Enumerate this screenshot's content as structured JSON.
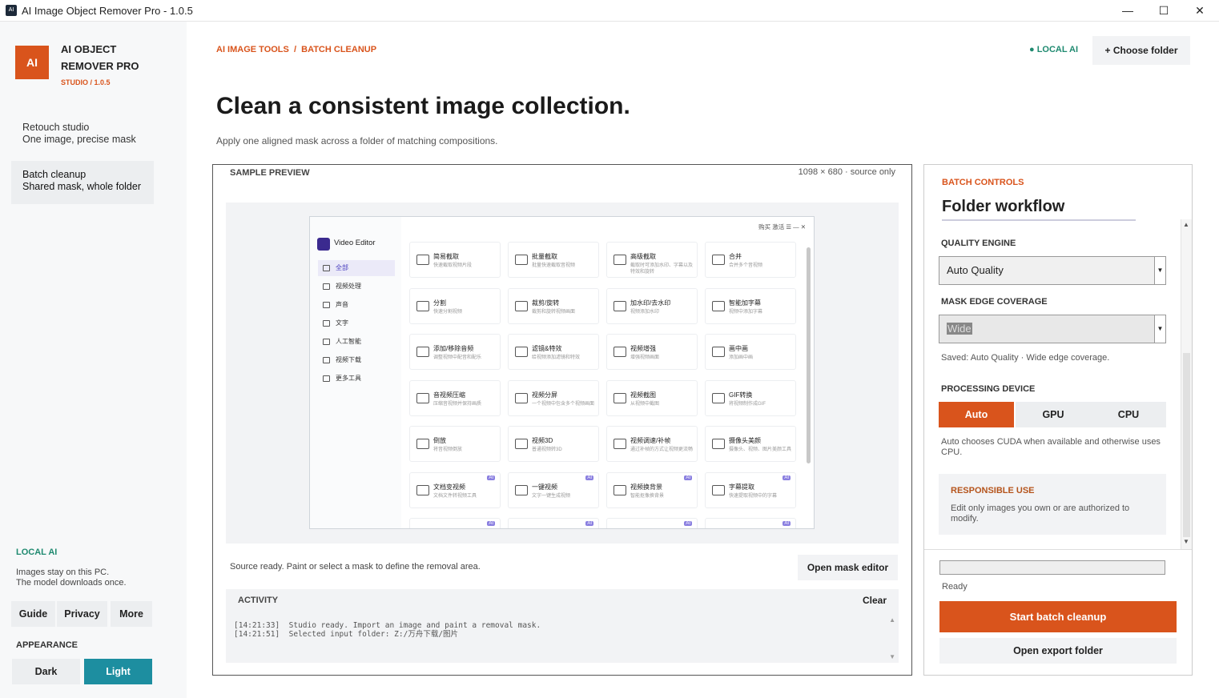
{
  "window": {
    "title": "AI Image Object Remover Pro - 1.0.5",
    "icon_text": "AI",
    "minimize": "—",
    "maximize": "☐",
    "close": "✕"
  },
  "brand": {
    "logo": "AI",
    "name": "AI OBJECT REMOVER PRO",
    "sub": "STUDIO / 1.0.5"
  },
  "nav": [
    {
      "title": "Retouch studio",
      "sub": "One image, precise mask"
    },
    {
      "title": "Batch cleanup",
      "sub": "Shared mask, whole folder"
    }
  ],
  "sidebar_local": {
    "title": "LOCAL AI",
    "text": "Images stay on this PC.\nThe model downloads once."
  },
  "sidebar_buttons": [
    "Guide",
    "Privacy",
    "More"
  ],
  "appearance": {
    "label": "APPEARANCE",
    "dark": "Dark",
    "light": "Light",
    "accent": "#1d8ea0"
  },
  "header": {
    "breadcrumb": "AI IMAGE TOOLS  /  BATCH CLEANUP",
    "local_ai": "● LOCAL AI",
    "choose_folder": "+ Choose folder"
  },
  "main": {
    "title": "Clean a consistent image collection.",
    "subtitle": "Apply one aligned mask across a folder of matching compositions."
  },
  "preview": {
    "label": "SAMPLE PREVIEW",
    "size": "1098 × 680  ·  source only",
    "status": "Source ready. Paint or select a mask to define the removal area.",
    "mask_button": "Open mask editor"
  },
  "inner_app": {
    "title": "Video Editor",
    "top_links": "购买  激活   ☰  —  ✕",
    "nav": [
      "全部",
      "视频处理",
      "声音",
      "文字",
      "人工智能",
      "视频下载",
      "更多工具"
    ],
    "tiles": [
      {
        "t": "简易截取",
        "s": "快速截取视频片段"
      },
      {
        "t": "批量截取",
        "s": "批量快速截取音视频"
      },
      {
        "t": "高级截取",
        "s": "截取时可添加水印、字幕以及特效和旋转"
      },
      {
        "t": "合并",
        "s": "合并多个音视频"
      },
      {
        "t": "分割",
        "s": "快速分割视频"
      },
      {
        "t": "裁剪/旋转",
        "s": "裁剪和旋转视频画面"
      },
      {
        "t": "加水印/去水印",
        "s": "视频添加水印"
      },
      {
        "t": "智能加字幕",
        "s": "视频中添加字幕"
      },
      {
        "t": "添加/移除音频",
        "s": "调整视频中配音和配乐"
      },
      {
        "t": "滤镜&特效",
        "s": "给视频添加滤镜和特效"
      },
      {
        "t": "视频增强",
        "s": "增强视频画面"
      },
      {
        "t": "画中画",
        "s": "添加画中画"
      },
      {
        "t": "音视频压缩",
        "s": "压缩音视频并保持画质"
      },
      {
        "t": "视频分屏",
        "s": "一个视频中包含多个视频画面"
      },
      {
        "t": "视频截图",
        "s": "从视频中截图"
      },
      {
        "t": "GIF转换",
        "s": "将视频制作成GIF"
      },
      {
        "t": "倒放",
        "s": "将音视频倒放"
      },
      {
        "t": "视频3D",
        "s": "普通视频转3D"
      },
      {
        "t": "视频调速/补帧",
        "s": "通过补帧的方式让视频更流畅"
      },
      {
        "t": "摄像头美颜",
        "s": "摄像头、视频、图片美颜工具"
      },
      {
        "t": "文档变视频",
        "s": "文档文件转视频工具"
      },
      {
        "t": "一键视频",
        "s": "文字一键生成视频"
      },
      {
        "t": "视频换背景",
        "s": "智能抠像换背景"
      },
      {
        "t": "字幕提取",
        "s": "快速提取视频中的字幕"
      }
    ],
    "ai_badge": "AI"
  },
  "activity": {
    "title": "ACTIVITY",
    "clear": "Clear",
    "log": "[14:21:33]  Studio ready. Import an image and paint a removal mask.\n[14:21:51]  Selected input folder: Z:/万舟下载/图片"
  },
  "controls": {
    "label": "BATCH CONTROLS",
    "title": "Folder workflow",
    "quality_label": "QUALITY ENGINE",
    "quality_value": "Auto Quality",
    "edge_label": "MASK EDGE COVERAGE",
    "edge_value": "Wide",
    "saved": "Saved: Auto Quality · Wide edge coverage.",
    "device_label": "PROCESSING DEVICE",
    "devices": [
      "Auto",
      "GPU",
      "CPU"
    ],
    "device_note": "Auto chooses CUDA when available and otherwise uses CPU.",
    "resp_title": "RESPONSIBLE USE",
    "resp_text": "Edit only images you own or are authorized to modify.",
    "ready": "Ready",
    "start": "Start batch cleanup",
    "export": "Open export folder",
    "progress": 0
  },
  "colors": {
    "accent": "#d9541c",
    "local_green": "#1f8a70"
  }
}
